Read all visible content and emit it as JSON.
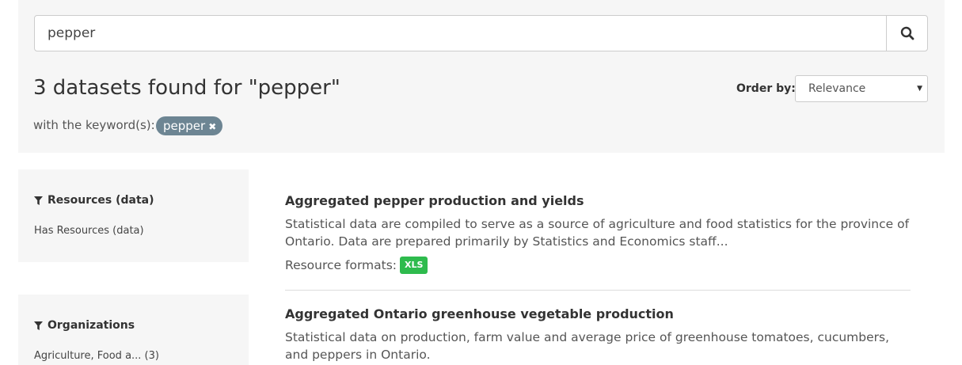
{
  "search": {
    "query": "pepper"
  },
  "results": {
    "heading": "3 datasets found for \"pepper\"",
    "keyword_label": "with the keyword(s):",
    "keywords": [
      "pepper"
    ],
    "order_label": "Order by:",
    "order_value": "Relevance"
  },
  "facets": [
    {
      "title": "Resources (data)",
      "items": [
        "Has Resources (data)"
      ]
    },
    {
      "title": "Organizations",
      "items": [
        "Agriculture, Food a... (3)"
      ]
    }
  ],
  "datasets": [
    {
      "title": "Aggregated pepper production and yields",
      "description": "Statistical data are compiled to serve as a source of agriculture and food statistics for the province of Ontario. Data are prepared primarily by Statistics and Economics staff...",
      "formats_label": "Resource formats:",
      "formats": [
        "XLS"
      ]
    },
    {
      "title": "Aggregated Ontario greenhouse vegetable production",
      "description": "Statistical data on production, farm value and average price of greenhouse tomatoes, cucumbers, and peppers in Ontario."
    }
  ],
  "icons": {
    "search": "search-icon",
    "filter": "filter-icon",
    "remove": "close-icon",
    "caret": "caret-down-icon"
  },
  "colors": {
    "panel_bg": "#f6f6f6",
    "pill_bg": "#6d8593",
    "format_badge": "#2ebb4d"
  }
}
